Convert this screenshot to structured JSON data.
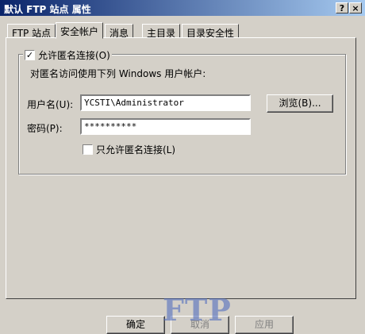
{
  "window": {
    "title": "默认 FTP 站点 属性",
    "help_label": "?",
    "close_label": "×"
  },
  "tabs": [
    {
      "label": "FTP 站点"
    },
    {
      "label": "安全帐户"
    },
    {
      "label": "消息"
    },
    {
      "label": "主目录"
    },
    {
      "label": "目录安全性"
    }
  ],
  "group": {
    "checkbox_label": "允许匿名连接(O)",
    "checked_mark": "✓",
    "description": "对匿名访问使用下列 Windows 用户帐户:"
  },
  "form": {
    "username_label": "用户名(U):",
    "username_value": "YCSTI\\Administrator",
    "browse_label": "浏览(B)...",
    "password_label": "密码(P):",
    "password_value": "**********",
    "anon_only_label": "只允许匿名连接(L)"
  },
  "buttons": {
    "ok": "确定",
    "cancel": "取消",
    "apply": "应用"
  },
  "watermark": {
    "text": "FTP"
  }
}
